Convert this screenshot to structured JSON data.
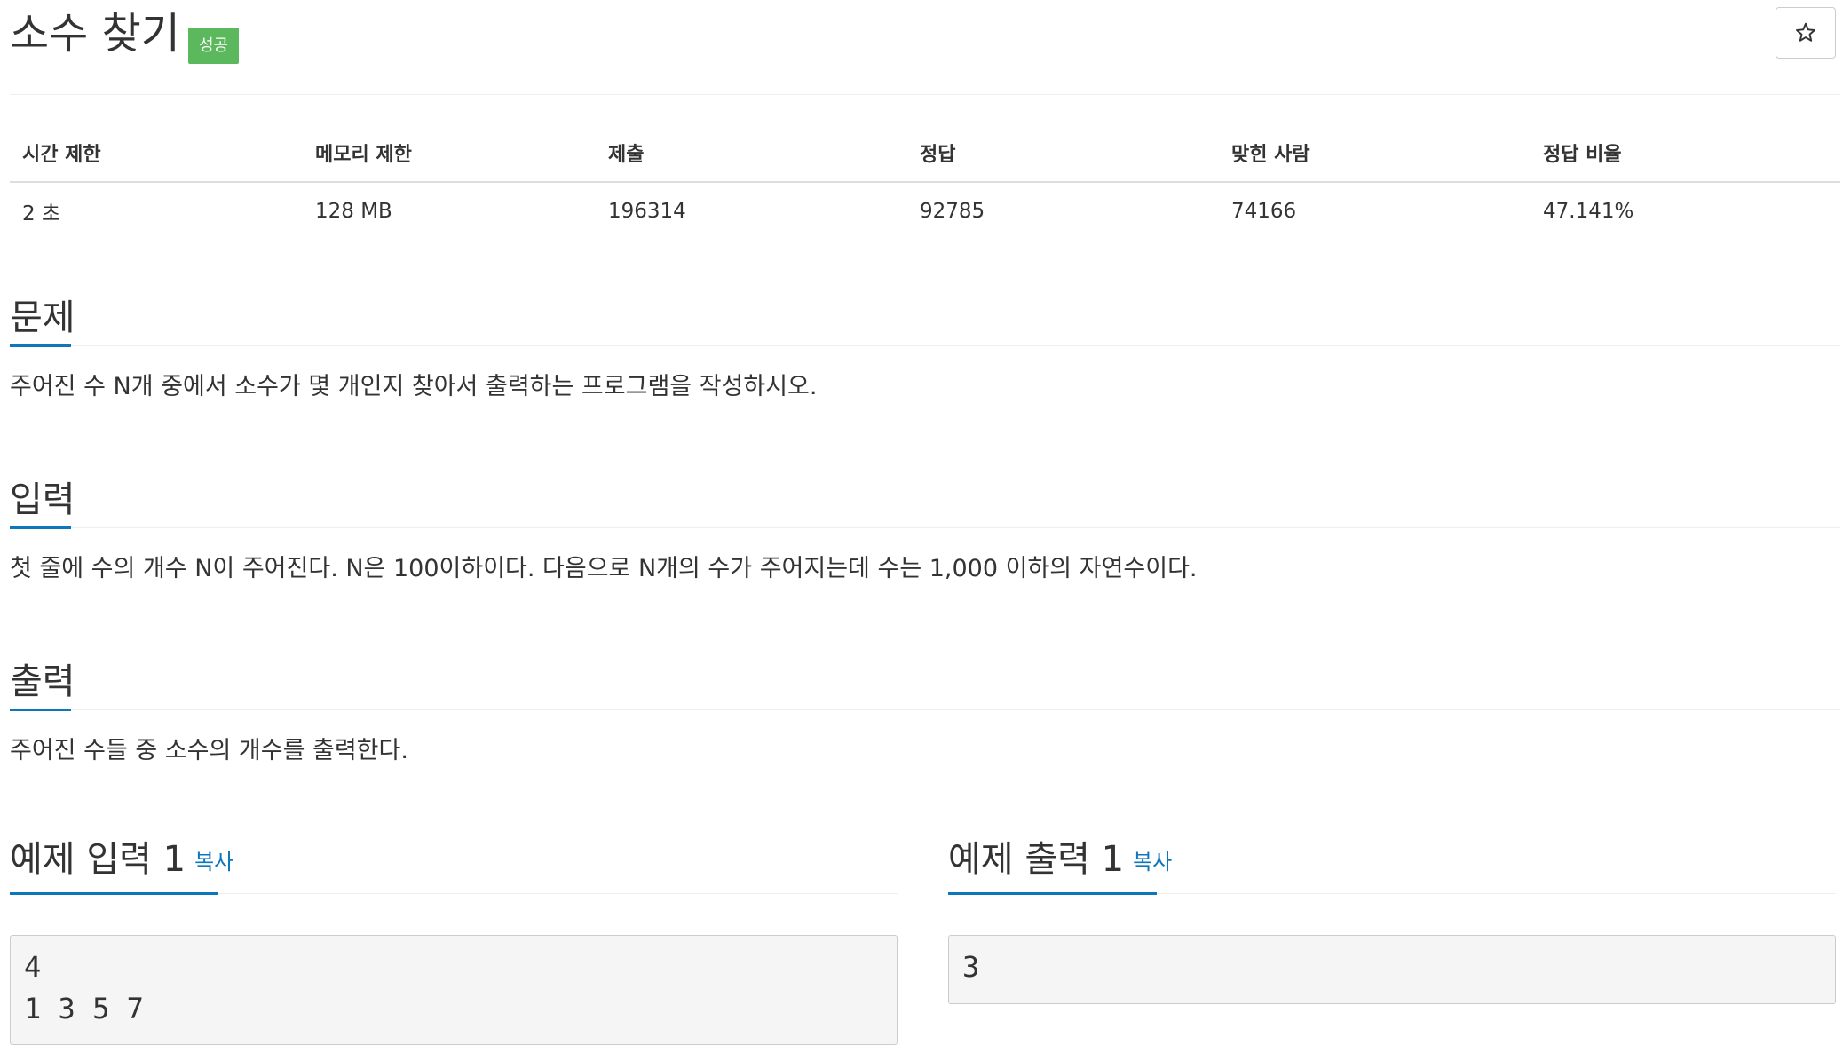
{
  "problem": {
    "title": "소수 찾기",
    "status_badge": "성공",
    "star_icon": "star-outline-icon"
  },
  "info_table": {
    "headers": [
      "시간 제한",
      "메모리 제한",
      "제출",
      "정답",
      "맞힌 사람",
      "정답 비율"
    ],
    "values": [
      "2 초",
      "128 MB",
      "196314",
      "92785",
      "74166",
      "47.141%"
    ]
  },
  "sections": {
    "description": {
      "title": "문제",
      "text": "주어진 수 N개 중에서 소수가 몇 개인지 찾아서 출력하는 프로그램을 작성하시오."
    },
    "input": {
      "title": "입력",
      "text": "첫 줄에 수의 개수 N이 주어진다. N은 100이하이다. 다음으로 N개의 수가 주어지는데 수는 1,000 이하의 자연수이다."
    },
    "output": {
      "title": "출력",
      "text": "주어진 수들 중 소수의 개수를 출력한다."
    }
  },
  "samples": {
    "input": {
      "title": "예제 입력 1",
      "copy_label": "복사",
      "content": "4\n1 3 5 7"
    },
    "output": {
      "title": "예제 출력 1",
      "copy_label": "복사",
      "content": "3"
    }
  },
  "colors": {
    "accent": "#0e76bd",
    "success_badge": "#5cb85c",
    "sample_background": "#f5f5f5"
  }
}
